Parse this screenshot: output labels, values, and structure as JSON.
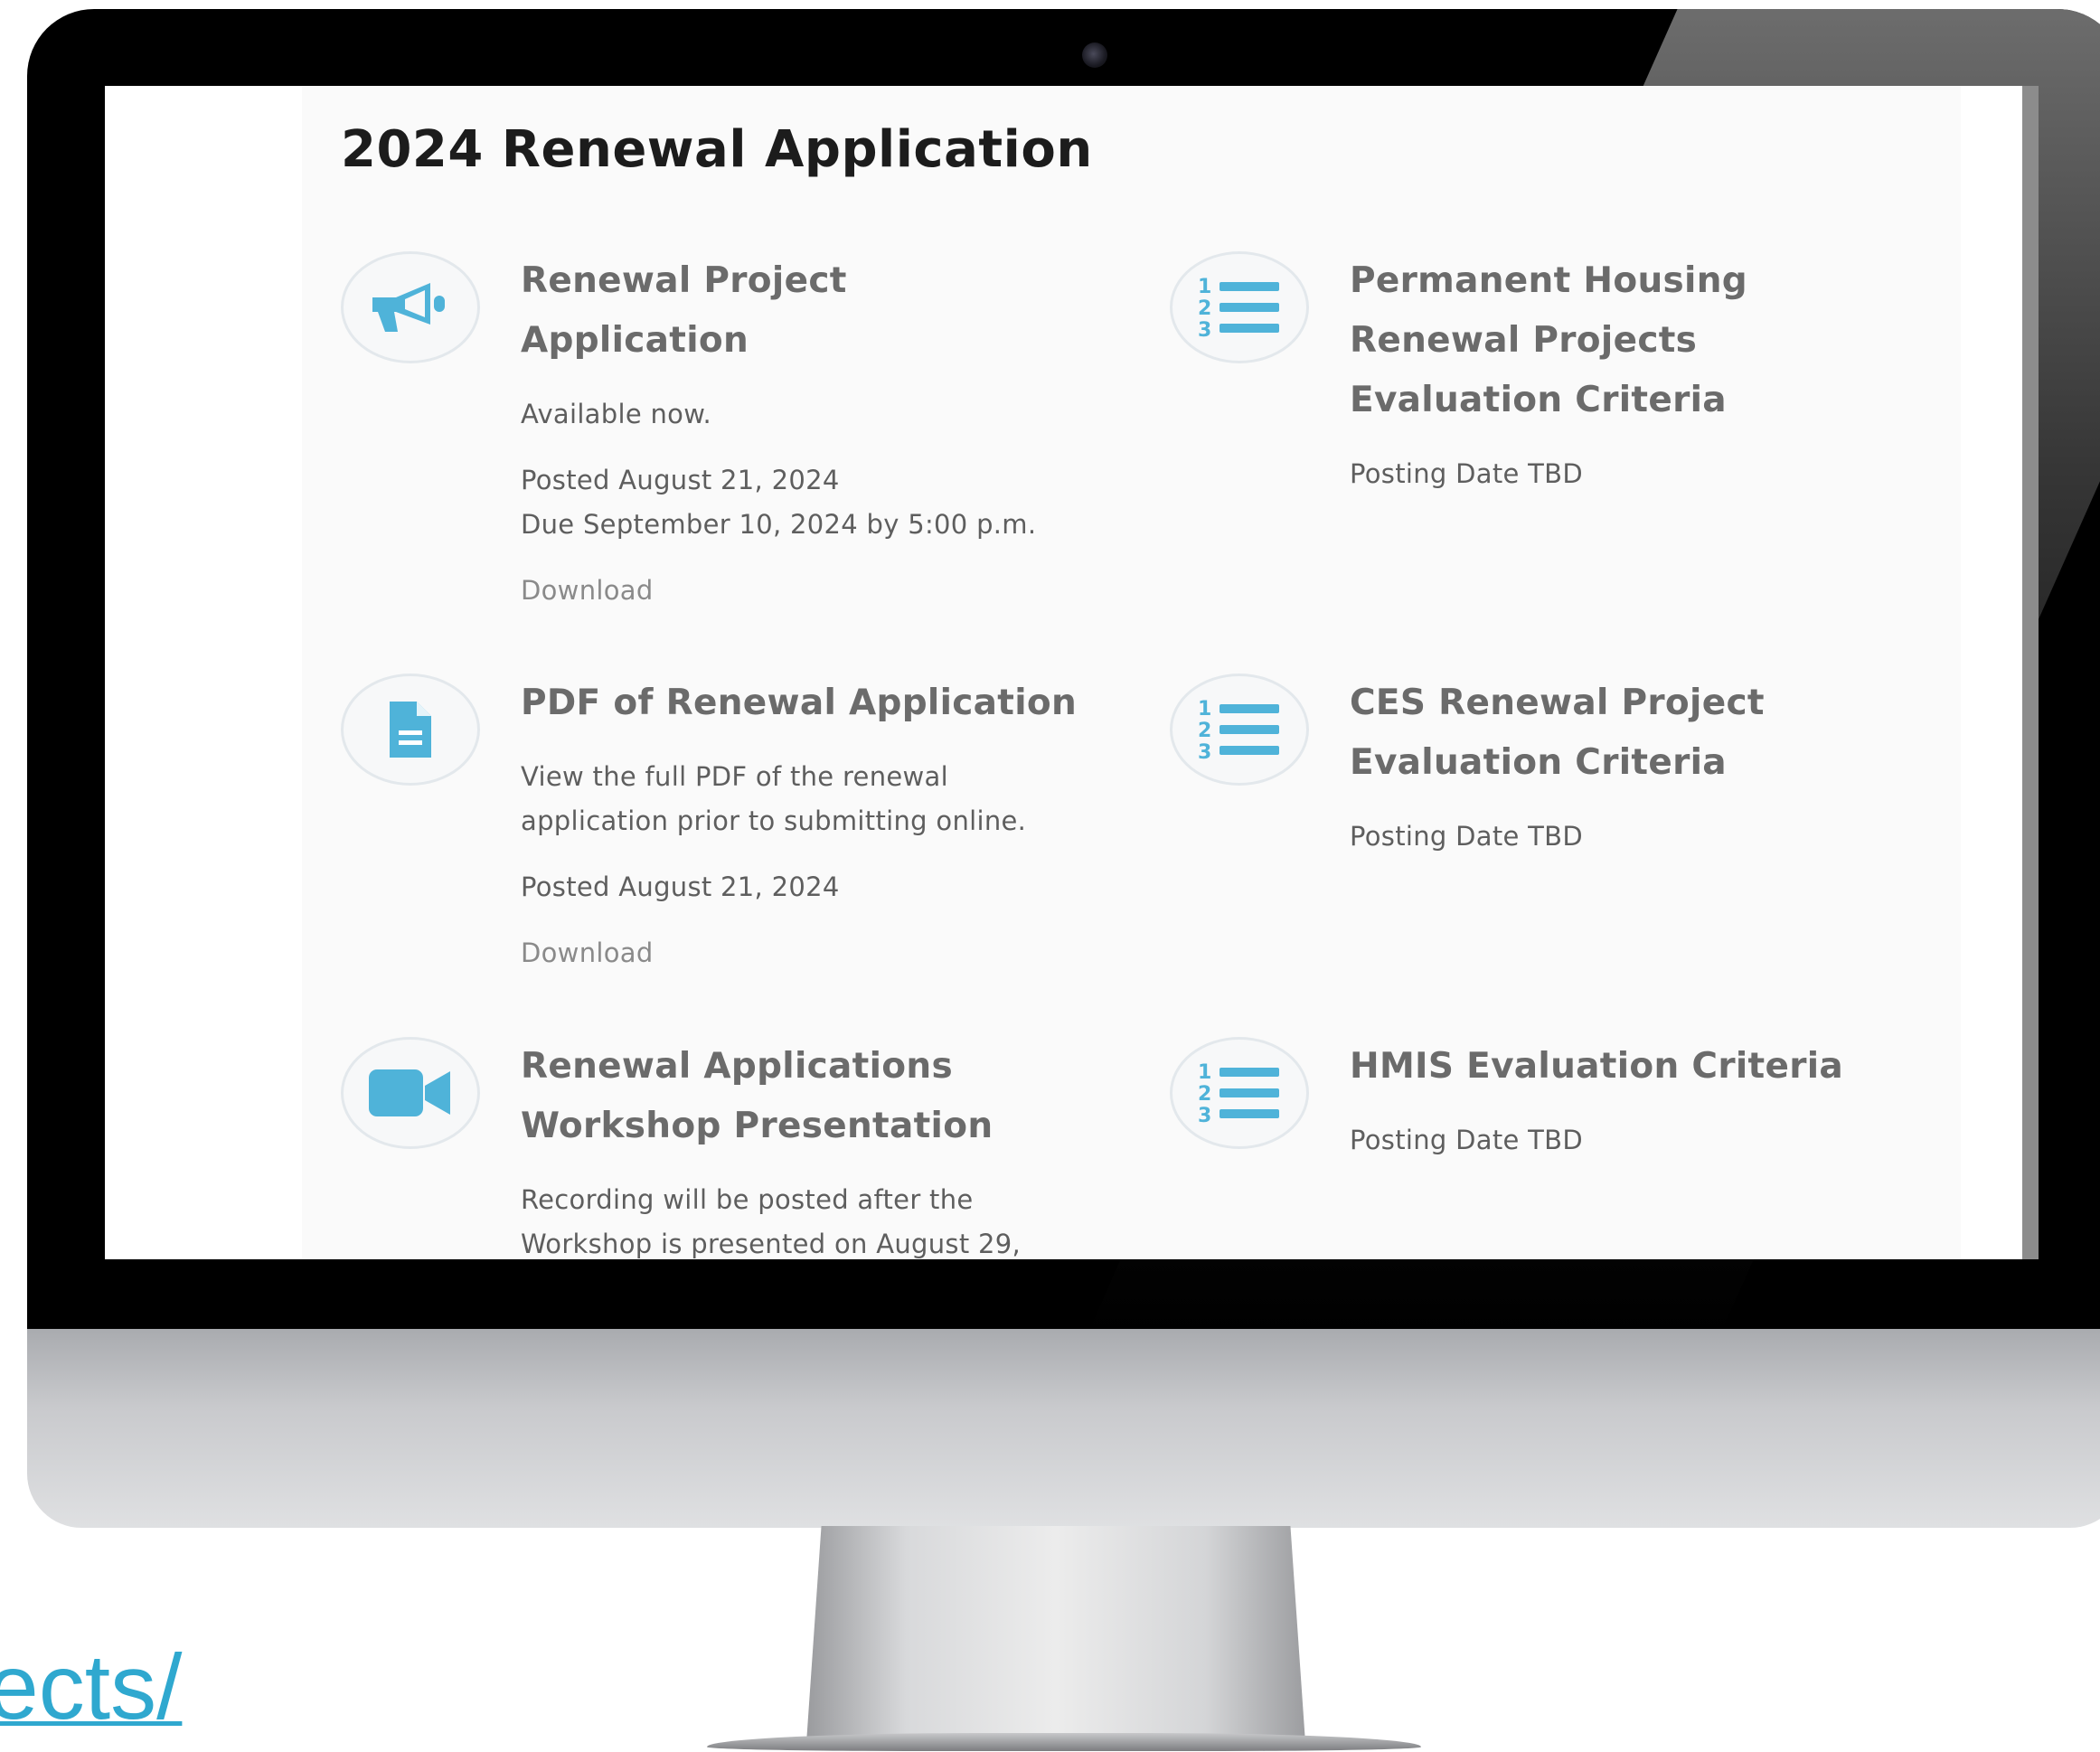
{
  "url_fragment": "ects/",
  "page": {
    "title": "2024 Renewal Application"
  },
  "left_items": [
    {
      "title_lines": [
        "Renewal Project",
        "Application"
      ],
      "lines": [
        "Available now.",
        "Posted August 21, 2024",
        "Due September 10, 2024 by 5:00 p.m."
      ],
      "link": "Download",
      "icon": "megaphone-icon"
    },
    {
      "title_lines": [
        "PDF of Renewal Application"
      ],
      "lines": [
        "View the full PDF of the renewal",
        "application prior to submitting online.",
        "Posted August 21, 2024"
      ],
      "link": "Download",
      "icon": "document-icon"
    },
    {
      "title_lines": [
        "Renewal Applications",
        "Workshop Presentation"
      ],
      "lines": [
        "Recording will be posted after the",
        "Workshop is presented on August 29,"
      ],
      "icon": "video-camera-icon"
    }
  ],
  "right_items": [
    {
      "title_lines": [
        "Permanent Housing",
        "Renewal Projects",
        "Evaluation Criteria"
      ],
      "lines": [
        "Posting Date TBD"
      ],
      "icon": "numbered-list-icon"
    },
    {
      "title_lines": [
        "CES Renewal Project",
        "Evaluation Criteria"
      ],
      "lines": [
        "Posting Date TBD"
      ],
      "icon": "numbered-list-icon"
    },
    {
      "title_lines": [
        "HMIS Evaluation Criteria"
      ],
      "lines": [
        "Posting Date TBD"
      ],
      "icon": "numbered-list-icon"
    }
  ],
  "colors": {
    "icon_accent": "#4fb3d9",
    "title_text": "#6b6b6b",
    "body_text": "#5e5e5e",
    "url_link": "#2fa8cf"
  }
}
